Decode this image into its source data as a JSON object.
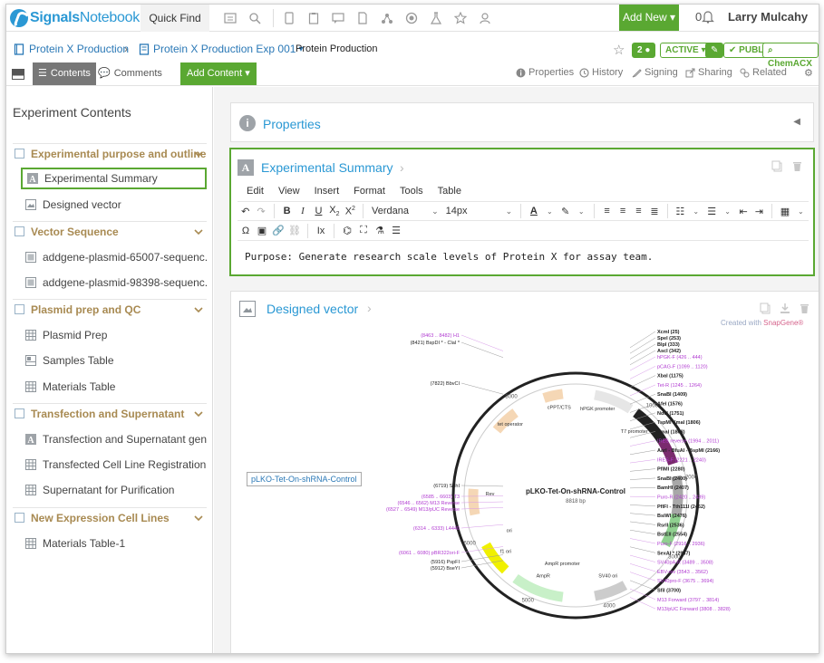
{
  "app": {
    "logo_bold": "Signals",
    "logo_light": "Notebook",
    "quick_find": "Quick Find",
    "add_new": "Add New",
    "notification_count": "0",
    "user_name": "Larry Mulcahy"
  },
  "breadcrumb": {
    "project": "Protein X Production",
    "experiment": "Protein X Production Exp 001",
    "current": "Protein Production",
    "comment_count": "2",
    "status": "ACTIVE",
    "visibility": "PUBLIC",
    "chem": "ChemACX"
  },
  "tabs": {
    "contents": "Contents",
    "comments": "Comments",
    "add_content": "Add Content",
    "properties": "Properties",
    "history": "History",
    "signing": "Signing",
    "sharing": "Sharing",
    "related": "Related"
  },
  "sidebar": {
    "title": "Experiment Contents",
    "sections": [
      {
        "label": "Experimental purpose and outline",
        "items": [
          "Experimental Summary",
          "Designed vector"
        ]
      },
      {
        "label": "Vector Sequence",
        "items": [
          "addgene-plasmid-65007-sequenc...",
          "addgene-plasmid-98398-sequenc..."
        ]
      },
      {
        "label": "Plasmid prep and QC",
        "items": [
          "Plasmid Prep",
          "Samples Table",
          "Materials Table"
        ]
      },
      {
        "label": "Transfection and Supernatant",
        "items": [
          "Transfection and Supernatant gen...",
          "Transfected Cell Line Registration",
          "Supernatant for Purification"
        ]
      },
      {
        "label": "New Expression Cell Lines",
        "items": [
          "Materials Table-1"
        ]
      }
    ]
  },
  "properties_card": {
    "title": "Properties"
  },
  "summary_card": {
    "title": "Experimental Summary",
    "menu": [
      "Edit",
      "View",
      "Insert",
      "Format",
      "Tools",
      "Table"
    ],
    "font": "Verdana",
    "size": "14px",
    "content": "Purpose: Generate research scale levels of Protein X for assay team."
  },
  "vector_card": {
    "title": "Designed vector",
    "snap_prefix": "Created with",
    "snap_brand": "SnapGene®",
    "tooltip": "pLKO-Tet-On-shRNA-Control",
    "map": {
      "name": "pLKO-Tet-On-shRNA-Control",
      "length": "8818 bp",
      "left_labels": [
        "(8463 .. 8482) H1",
        "(8421) BspDI * - ClaI *",
        "(7822) BbvCI",
        "(6719) SphI",
        "(6585 .. 6603) T3",
        "(6546 .. 6562) M13 Reverse",
        "(6527 .. 6549) M13/pUC Reverse",
        "(6314 .. 6333) L4440",
        "(6061 .. 6080) pBR322ori-F",
        "(5916) PspFI",
        "(5912) BseYI"
      ],
      "right_labels": [
        "XcmI (25)",
        "SpeI (253)",
        "BlpI (333)",
        "AscI (342)",
        "hPGK-F (426 .. 444)",
        "pCAG-F (1099 .. 1120)",
        "XbaI (1175)",
        "Tet-R (1245 .. 1264)",
        "SnaBI (1409)",
        "AfeI (1576)",
        "NdeI (1751)",
        "TspMI  XmaI (1806)",
        "SmaI (1808)",
        "IRES reverse (1994 .. 2011)",
        "AarI - BfuAI - BspMI (2166)",
        "IRES-F (2221 .. 2240)",
        "PflMI (2280)",
        "SnaBI (2400)",
        "BamHI (2407)",
        "Puro-R (2420 .. 2439)",
        "PflFI - Tth111I (2462)",
        "BsiWI (2476)",
        "RsrII (2536)",
        "BstEII (2554)",
        "Puro-F (2916 .. 2936)",
        "SexAI * (2987)",
        "SV40pA-R (3489 .. 3508)",
        "EBV-rev (3543 .. 3562)",
        "SV40pro-F (3675 .. 3694)",
        "SfiI (3700)",
        "M13 Forward (3797 .. 3814)",
        "M13/pUC Forward (3808 .. 3828)"
      ],
      "features": [
        "tet operator",
        "cPPT/CTS",
        "hPGK promoter",
        "T7 promoter",
        "AmpR",
        "AmpR promoter",
        "f1 ori",
        "SV40 ori",
        "ori",
        "Rev"
      ],
      "ticks": [
        "1000",
        "2000",
        "3000",
        "4000",
        "5000",
        "6000",
        "8000"
      ]
    }
  }
}
